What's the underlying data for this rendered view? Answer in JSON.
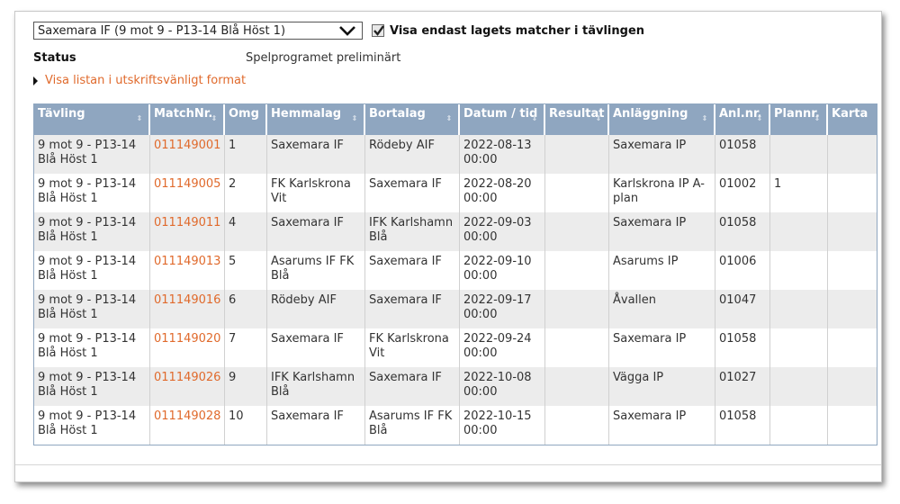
{
  "filter": {
    "select_value": "Saxemara IF (9 mot 9 - P13-14 Blå Höst 1)",
    "checkbox_checked": true,
    "checkbox_label": "Visa endast lagets matcher i tävlingen"
  },
  "status": {
    "label": "Status",
    "value": "Spelprogramet preliminärt"
  },
  "print_link": "Visa listan i utskriftsvänligt format",
  "table": {
    "headers": [
      "Tävling",
      "MatchNr.",
      "Omg",
      "Hemmalag",
      "Bortalag",
      "Datum / tid",
      "Resultat",
      "Anläggning",
      "Anl.nr.",
      "Plannr.",
      "Karta"
    ],
    "rows": [
      {
        "tavling": "9 mot 9 - P13-14 Blå Höst 1",
        "matchnr": "011149001",
        "omg": "1",
        "hemmalag": "Saxemara IF",
        "bortalag": "Rödeby AIF",
        "datum": "2022-08-13 00:00",
        "resultat": "",
        "anlaggning": "Saxemara IP",
        "anlnr": "01058",
        "plannr": "",
        "karta": ""
      },
      {
        "tavling": "9 mot 9 - P13-14 Blå Höst 1",
        "matchnr": "011149005",
        "omg": "2",
        "hemmalag": "FK Karlskrona Vit",
        "bortalag": "Saxemara IF",
        "datum": "2022-08-20 00:00",
        "resultat": "",
        "anlaggning": "Karlskrona IP A-plan",
        "anlnr": "01002",
        "plannr": "1",
        "karta": ""
      },
      {
        "tavling": "9 mot 9 - P13-14 Blå Höst 1",
        "matchnr": "011149011",
        "omg": "4",
        "hemmalag": "Saxemara IF",
        "bortalag": "IFK Karlshamn Blå",
        "datum": "2022-09-03 00:00",
        "resultat": "",
        "anlaggning": "Saxemara IP",
        "anlnr": "01058",
        "plannr": "",
        "karta": ""
      },
      {
        "tavling": "9 mot 9 - P13-14 Blå Höst 1",
        "matchnr": "011149013",
        "omg": "5",
        "hemmalag": "Asarums IF FK Blå",
        "bortalag": "Saxemara IF",
        "datum": "2022-09-10 00:00",
        "resultat": "",
        "anlaggning": "Asarums IP",
        "anlnr": "01006",
        "plannr": "",
        "karta": ""
      },
      {
        "tavling": "9 mot 9 - P13-14 Blå Höst 1",
        "matchnr": "011149016",
        "omg": "6",
        "hemmalag": "Rödeby AIF",
        "bortalag": "Saxemara IF",
        "datum": "2022-09-17 00:00",
        "resultat": "",
        "anlaggning": "Åvallen",
        "anlnr": "01047",
        "plannr": "",
        "karta": ""
      },
      {
        "tavling": "9 mot 9 - P13-14 Blå Höst 1",
        "matchnr": "011149020",
        "omg": "7",
        "hemmalag": "Saxemara IF",
        "bortalag": "FK Karlskrona Vit",
        "datum": "2022-09-24 00:00",
        "resultat": "",
        "anlaggning": "Saxemara IP",
        "anlnr": "01058",
        "plannr": "",
        "karta": ""
      },
      {
        "tavling": "9 mot 9 - P13-14 Blå Höst 1",
        "matchnr": "011149026",
        "omg": "9",
        "hemmalag": "IFK Karlshamn Blå",
        "bortalag": "Saxemara IF",
        "datum": "2022-10-08 00:00",
        "resultat": "",
        "anlaggning": "Vägga IP",
        "anlnr": "01027",
        "plannr": "",
        "karta": ""
      },
      {
        "tavling": "9 mot 9 - P13-14 Blå Höst 1",
        "matchnr": "011149028",
        "omg": "10",
        "hemmalag": "Saxemara IF",
        "bortalag": "Asarums IF FK Blå",
        "datum": "2022-10-15 00:00",
        "resultat": "",
        "anlaggning": "Saxemara IP",
        "anlnr": "01058",
        "plannr": "",
        "karta": ""
      }
    ]
  },
  "colors": {
    "header_bg": "#8fa6c0",
    "link": "#e06a2c",
    "row_alt": "#ececec"
  }
}
